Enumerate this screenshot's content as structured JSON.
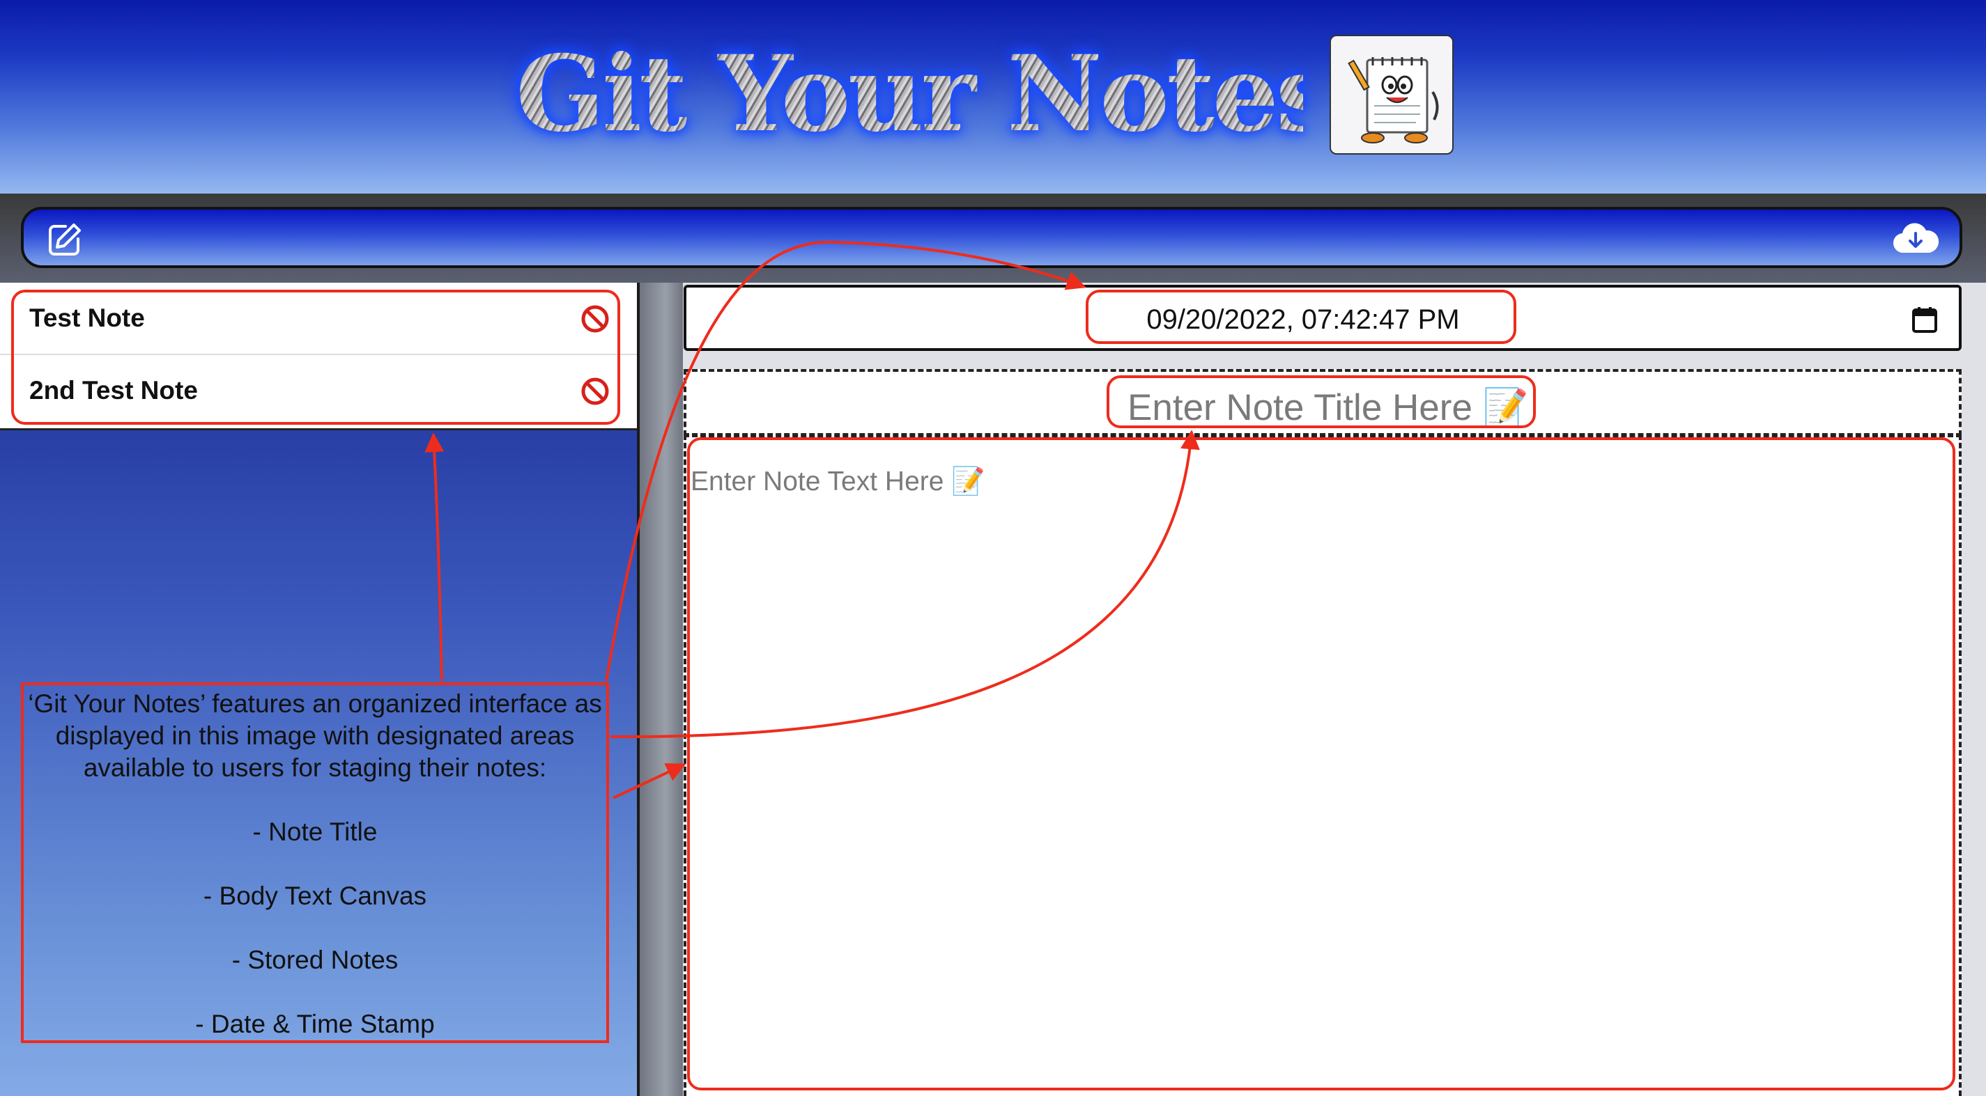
{
  "header": {
    "app_title": "Git Your Notes",
    "logo_icon": "notepad-mascot-icon"
  },
  "toolbar": {
    "new_note_icon": "edit-icon",
    "save_icon": "cloud-download-icon"
  },
  "notes": [
    {
      "title": "Test Note",
      "delete_icon": "prohibited-icon"
    },
    {
      "title": "2nd Test Note",
      "delete_icon": "prohibited-icon"
    }
  ],
  "editor": {
    "date_value": "09/20/2022, 07:42:47 PM",
    "calendar_icon": "calendar-icon",
    "title_placeholder": "Enter Note Title Here",
    "body_placeholder": "Enter Note Text Here",
    "placeholder_icon": "📝"
  },
  "callout": {
    "intro": "‘Git Your Notes’ features an organized interface as displayed in this image with designated areas available to users for staging their notes:",
    "items": [
      "- Note Title",
      "- Body Text Canvas",
      "- Stored Notes",
      "- Date & Time Stamp"
    ]
  },
  "colors": {
    "annotation": "#ee2c1c",
    "header_top": "#0a1ba9",
    "header_bottom": "#95b8f0"
  }
}
